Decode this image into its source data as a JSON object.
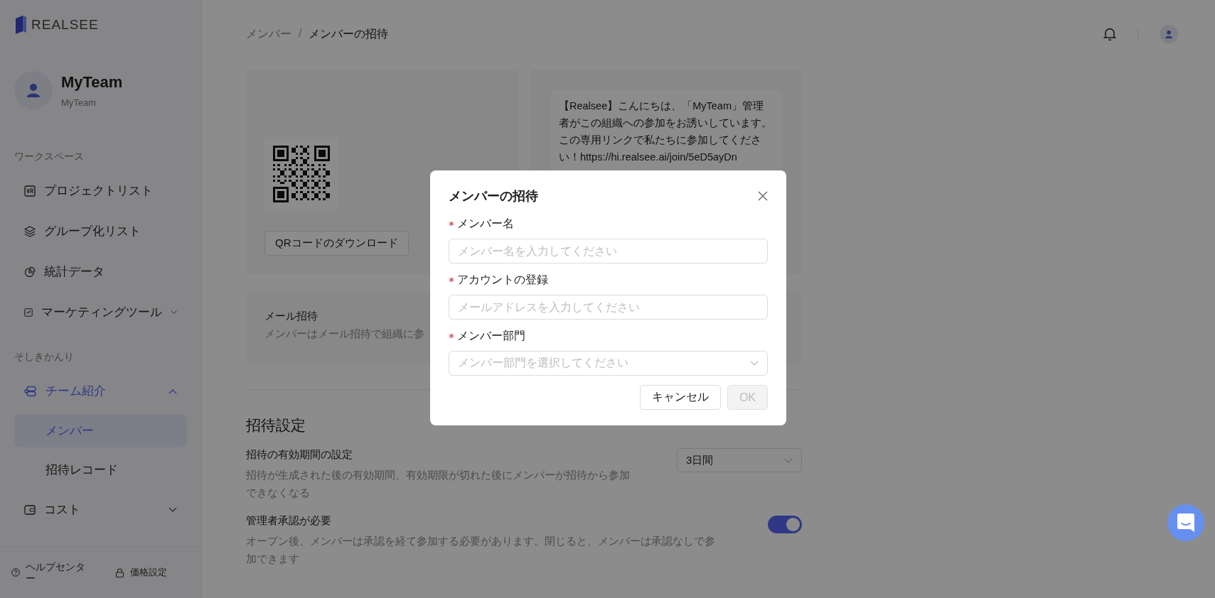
{
  "logo": {
    "text": "REALSEE"
  },
  "team": {
    "name": "MyTeam",
    "subtitle": "MyTeam"
  },
  "sidebar": {
    "sections": [
      {
        "heading": "ワークスペース",
        "items": [
          {
            "label": "プロジェクトリスト"
          },
          {
            "label": "グループ化リスト"
          },
          {
            "label": "統計データ"
          },
          {
            "label": "マーケティングツール",
            "expanded": false
          }
        ]
      },
      {
        "heading": "そしきかんり",
        "items": [
          {
            "label": "チーム紹介",
            "expanded": true,
            "selected": true,
            "children": [
              {
                "label": "メンバー",
                "selected": true
              },
              {
                "label": "招待レコード",
                "selected": false
              }
            ]
          },
          {
            "label": "コスト",
            "expanded": false,
            "selected": false
          }
        ]
      }
    ],
    "footer": [
      {
        "label": "ヘルプセンター"
      },
      {
        "label": "価格設定"
      }
    ]
  },
  "breadcrumb": {
    "items": [
      "メンバー",
      "メンバーの招待"
    ],
    "separator": "/"
  },
  "qr_card": {
    "download_button": "QRコードのダウンロード"
  },
  "message_card": {
    "text": "【Realsee】こんにちは、「MyTeam」管理者がこの組織への参加をお誘いしています。この専用リンクで私たちに参加してください！https://hi.realsee.ai/join/5eD5ayDn"
  },
  "mail_card": {
    "title": "メール招待",
    "description": "メンバーはメール招待で組織に参"
  },
  "settings": {
    "title": "招待設定",
    "items": [
      {
        "kind": "select",
        "title": "招待の有効期間の設定",
        "description": "招待が生成された後の有効期間、有効期限が切れた後にメンバーが招待から参加できなくなる",
        "value": "3日間"
      },
      {
        "kind": "toggle",
        "title": "管理者承認が必要",
        "description": "オープン後、メンバーは承認を経て参加する必要があります。閉じると、メンバーは承認なしで参加できます",
        "on": true
      }
    ]
  },
  "modal": {
    "title": "メンバーの招待",
    "fields": [
      {
        "kind": "input",
        "label": "メンバー名",
        "required": true,
        "placeholder": "メンバー名を入力してください"
      },
      {
        "kind": "input",
        "label": "アカウントの登録",
        "required": true,
        "placeholder": "メールアドレスを入力してください"
      },
      {
        "kind": "select",
        "label": "メンバー部門",
        "required": true,
        "placeholder": "メンバー部門を選択してください"
      }
    ],
    "buttons": [
      {
        "label": "キャンセル",
        "kind": "default",
        "disabled": false
      },
      {
        "label": "OK",
        "kind": "primary",
        "disabled": true
      }
    ]
  }
}
